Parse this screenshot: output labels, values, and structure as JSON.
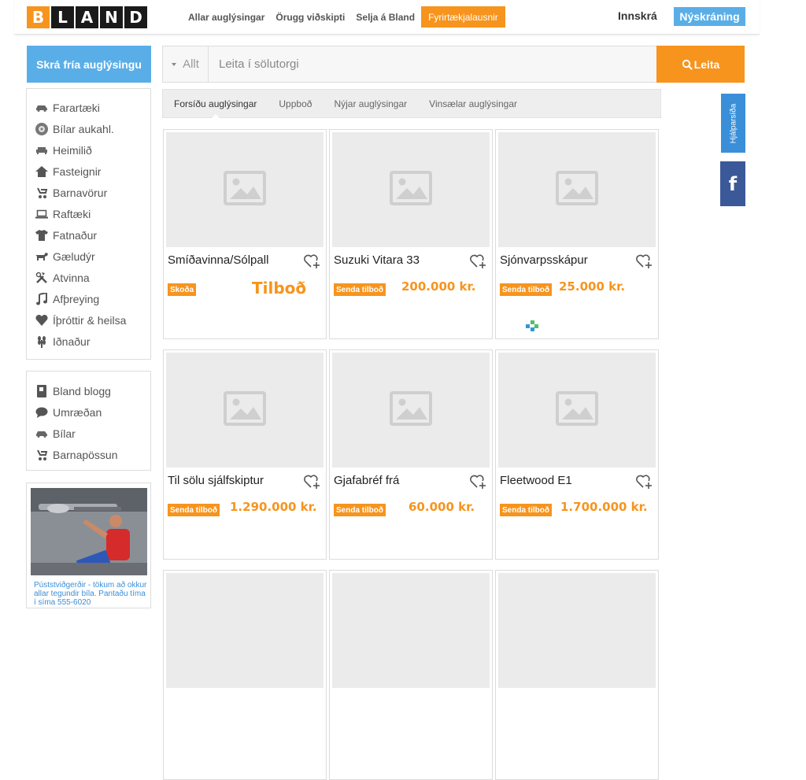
{
  "header": {
    "logo_letters": [
      "B",
      "L",
      "A",
      "N",
      "D"
    ],
    "nav": [
      {
        "label": "Allar auglýsingar",
        "highlight": false
      },
      {
        "label": "Örugg viðskipti",
        "highlight": false
      },
      {
        "label": "Selja á Bland",
        "highlight": false
      },
      {
        "label": "Fyrirtækjalausnir",
        "highlight": true
      }
    ],
    "login_label": "Innskrá",
    "signup_label": "Nýskráning"
  },
  "post_ad_label": "Skrá fría auglýsingu",
  "search": {
    "category": "Allt",
    "placeholder": "Leita í sölutorgi",
    "button_label": "Leita"
  },
  "sidebar": {
    "categories": [
      {
        "label": "Farartæki",
        "icon": "car-icon"
      },
      {
        "label": "Bílar aukahl.",
        "icon": "wheel-icon"
      },
      {
        "label": "Heimilið",
        "icon": "sofa-icon"
      },
      {
        "label": "Fasteignir",
        "icon": "house-icon"
      },
      {
        "label": "Barnavörur",
        "icon": "stroller-icon"
      },
      {
        "label": "Raftæki",
        "icon": "laptop-icon"
      },
      {
        "label": "Fatnaður",
        "icon": "shirt-icon"
      },
      {
        "label": "Gæludýr",
        "icon": "dog-icon"
      },
      {
        "label": "Atvinna",
        "icon": "tools-icon"
      },
      {
        "label": "Afþreying",
        "icon": "music-icon"
      },
      {
        "label": "Íþróttir & heilsa",
        "icon": "heart-icon"
      },
      {
        "label": "Iðnaður",
        "icon": "wheat-icon"
      }
    ],
    "links": [
      {
        "label": "Bland blogg",
        "icon": "book-icon"
      },
      {
        "label": "Umræðan",
        "icon": "chat-icon"
      },
      {
        "label": "Bílar",
        "icon": "car-icon"
      },
      {
        "label": "Barnapössun",
        "icon": "stroller-icon"
      }
    ],
    "ad_caption": "Púststviðgerðir - tökum að okkur allar tegundir bíla. Pantaðu tíma í síma 555-6020"
  },
  "tabs": [
    "Forsíðu auglýsingar",
    "Uppboð",
    "Nýjar auglýsingar",
    "Vinsælar auglýsingar"
  ],
  "listings": [
    {
      "title": "Smíðavinna/Sólpall",
      "badge": "Skoða",
      "price": "Tilboð",
      "price_style": "big",
      "has_puzzle": false
    },
    {
      "title": "Suzuki Vitara 33",
      "badge": "Senda tilboð",
      "price": "200.000 kr.",
      "price_style": "normal",
      "has_puzzle": false
    },
    {
      "title": "Sjónvarpsskápur",
      "badge": "Senda tilboð",
      "price": "25.000 kr.",
      "price_style": "normal",
      "has_puzzle": true
    },
    {
      "title": "Til sölu sjálfskiptur",
      "badge": "Senda tilboð",
      "price": "1.290.000 kr.",
      "price_style": "normal",
      "has_puzzle": false
    },
    {
      "title": "Gjafabréf frá",
      "badge": "Senda tilboð",
      "price": "60.000 kr.",
      "price_style": "normal",
      "has_puzzle": false
    },
    {
      "title": "Fleetwood E1",
      "badge": "Senda tilboð",
      "price": "1.700.000 kr.",
      "price_style": "normal",
      "has_puzzle": false
    }
  ],
  "side_tabs": {
    "help_label": "Hjálparsíða",
    "facebook_label": "f"
  },
  "colors": {
    "accent": "#f7941d",
    "blue": "#5aaee8",
    "facebook": "#3b5998"
  }
}
